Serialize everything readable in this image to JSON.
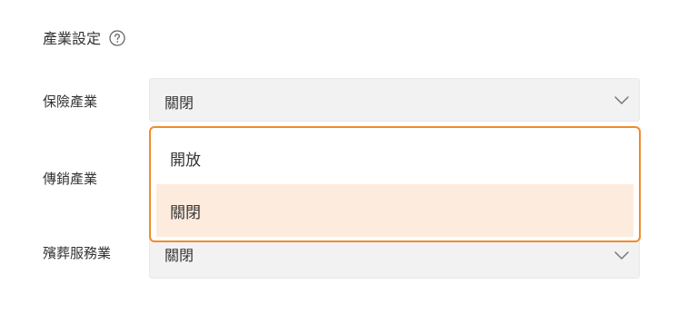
{
  "section": {
    "title": "產業設定",
    "help_icon": "question-circle-icon"
  },
  "rows": [
    {
      "label": "保險產業",
      "value": "關閉"
    },
    {
      "label": "傳銷產業",
      "value": ""
    },
    {
      "label": "殯葬服務業",
      "value": "關閉"
    }
  ],
  "dropdown": {
    "options": [
      "開放",
      "關閉"
    ],
    "selected": "關閉"
  },
  "colors": {
    "accent": "#f08c2b",
    "selected_option_bg": "#fdebdd",
    "select_bg": "#f2f2f2"
  }
}
